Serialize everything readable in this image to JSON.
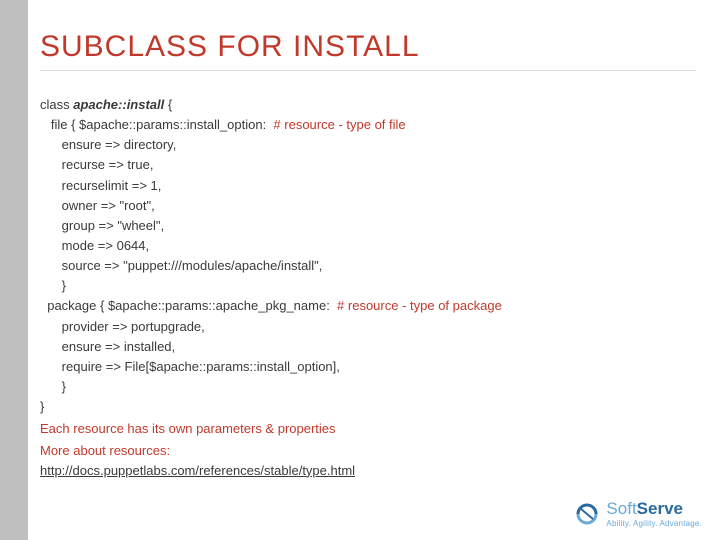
{
  "title": "SUBCLASS FOR INSTALL",
  "code": {
    "l1a": "class ",
    "l1b": "apache::install",
    "l1c": " { ",
    "l2a": "   file { $apache::params::install_option:  ",
    "l2b": "# resource - type of file",
    "l3": "      ensure => directory,",
    "l4": "      recurse => true,",
    "l5": "      recurselimit => 1,",
    "l6": "      owner => \"root\",",
    "l7": "      group => \"wheel\",",
    "l8": "      mode => 0644,",
    "l9": "      source => \"puppet:///modules/apache/install\",",
    "l10": "      }",
    "l11a": "  package { $apache::params::apache_pkg_name:  ",
    "l11b": "# resource - type of package",
    "l12": "      provider => portupgrade,",
    "l13": "      ensure => installed,",
    "l14": "      require => File[$apache::params::install_option],",
    "l15": "      }",
    "l16": "}"
  },
  "note1": "Each resource has its own parameters & properties",
  "note2": "More about resources:",
  "link": "http://docs.puppetlabs.com/references/stable/type.html",
  "logo": {
    "brand_soft": "Soft",
    "brand_serve": "Serve",
    "tagline": "Ability. Agility. Advantage."
  }
}
